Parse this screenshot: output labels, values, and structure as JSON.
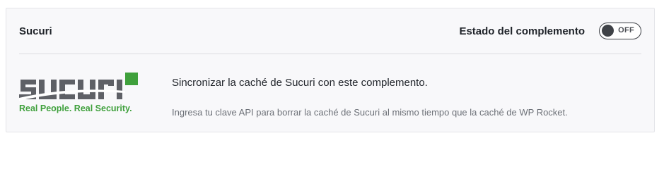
{
  "addon": {
    "title": "Sucuri",
    "status_label": "Estado del complemento",
    "toggle_state": "OFF",
    "logo_text": "sucuri",
    "logo_tagline": "Real People. Real Security.",
    "description_title": "Sincronizar la caché de Sucuri con este complemento.",
    "description_text": "Ingresa tu clave API para borrar la caché de Sucuri al mismo tiempo que la caché de WP Rocket."
  },
  "colors": {
    "logo_gray": "#5e6066",
    "logo_green": "#3fa03c",
    "card_bg": "#f8f8fa"
  }
}
